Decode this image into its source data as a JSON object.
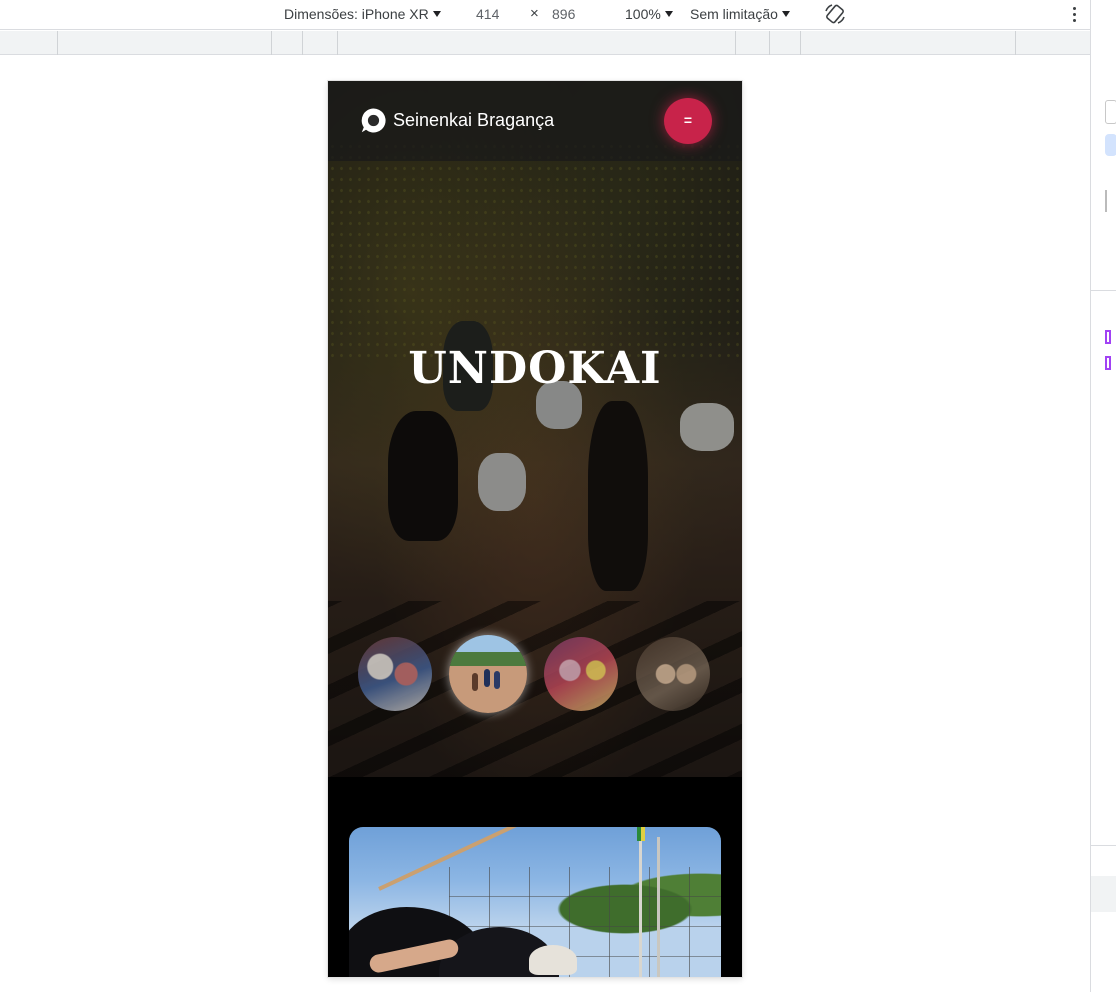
{
  "devtools": {
    "dimensions_label": "Dimensões: iPhone XR",
    "width": "414",
    "times": "×",
    "height": "896",
    "zoom": "100%",
    "throttle": "Sem limitação"
  },
  "site": {
    "brand": "Seinenkai Bragança",
    "menu_label": "=",
    "hero_title": "UNDOKAI",
    "accent_color": "#c8234a",
    "thumbnails": [
      {
        "name": "thumbnail-1"
      },
      {
        "name": "thumbnail-2",
        "active": true
      },
      {
        "name": "thumbnail-3"
      },
      {
        "name": "thumbnail-4"
      }
    ]
  }
}
